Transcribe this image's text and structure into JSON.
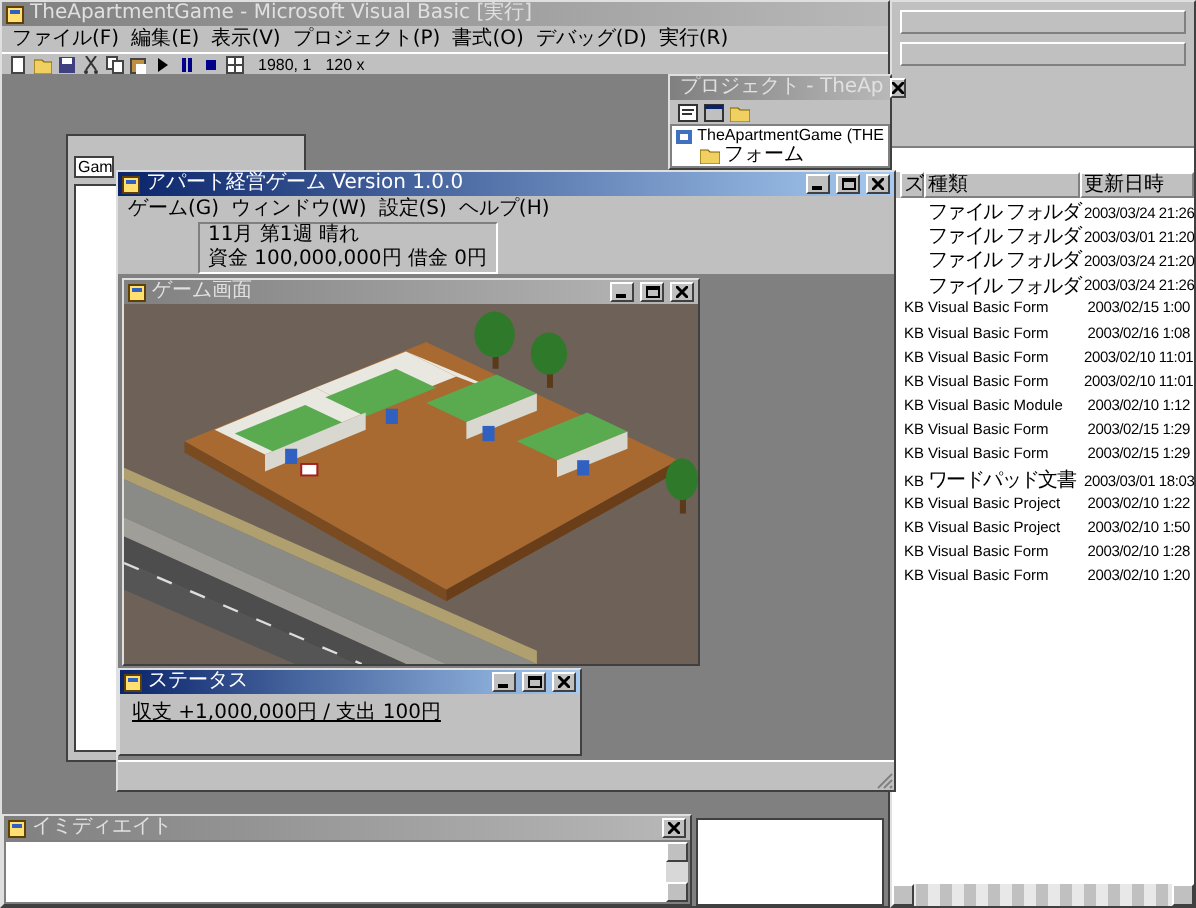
{
  "ide": {
    "title": "TheApartmentGame - Microsoft Visual Basic [実行]",
    "active": false,
    "menu": [
      "ファイル(F)",
      "編集(E)",
      "表示(V)",
      "プロジェクト(P)",
      "書式(O)",
      "デバッグ(D)",
      "実行(R)"
    ],
    "toolbar_readout": "1980, 1",
    "size_readout": "120 x"
  },
  "form_designer": {
    "combo_value": "Gam"
  },
  "project_explorer": {
    "title": "プロジェクト - TheAp",
    "active": false,
    "tree": [
      {
        "label": "TheApartmentGame (THE",
        "children": [
          {
            "label": "フォーム"
          }
        ]
      }
    ]
  },
  "file_list": {
    "columns": [
      "ズ",
      "種類",
      "更新日時"
    ],
    "rows": [
      {
        "size": "",
        "type": "ファイル フォルダ",
        "modified": "2003/03/24 21:26"
      },
      {
        "size": "",
        "type": "ファイル フォルダ",
        "modified": "2003/03/01 21:20"
      },
      {
        "size": "",
        "type": "ファイル フォルダ",
        "modified": "2003/03/24 21:20"
      },
      {
        "size": "",
        "type": "ファイル フォルダ",
        "modified": "2003/03/24 21:26"
      },
      {
        "size": "KB",
        "type": "Visual Basic Form",
        "modified": "2003/02/15 1:00"
      },
      {
        "size": "KB",
        "type": "Visual Basic Form",
        "modified": "2003/02/16 1:08"
      },
      {
        "size": "KB",
        "type": "Visual Basic Form",
        "modified": "2003/02/10 11:01"
      },
      {
        "size": "KB",
        "type": "Visual Basic Form",
        "modified": "2003/02/10 11:01"
      },
      {
        "size": "KB",
        "type": "Visual Basic Module",
        "modified": "2003/02/10 1:12"
      },
      {
        "size": "KB",
        "type": "Visual Basic Form",
        "modified": "2003/02/15 1:29"
      },
      {
        "size": "KB",
        "type": "Visual Basic Form",
        "modified": "2003/02/15 1:29"
      },
      {
        "size": "KB",
        "type": "ワードパッド文書",
        "modified": "2003/03/01 18:03"
      },
      {
        "size": "KB",
        "type": "Visual Basic Project",
        "modified": "2003/02/10 1:22"
      },
      {
        "size": "KB",
        "type": "Visual Basic Project",
        "modified": "2003/02/10 1:50"
      },
      {
        "size": "KB",
        "type": "Visual Basic Form",
        "modified": "2003/02/10 1:28"
      },
      {
        "size": "KB",
        "type": "Visual Basic Form",
        "modified": "2003/02/10 1:20"
      }
    ]
  },
  "game_window": {
    "title": "アパート経営ゲーム Version 1.0.0",
    "active": true,
    "menu": [
      "ゲーム(G)",
      "ウィンドウ(W)",
      "設定(S)",
      "ヘルプ(H)"
    ],
    "info": [
      "11月 第1週 晴れ",
      "資金 100,000,000円 借金 0円"
    ],
    "view_window": {
      "title": "ゲーム画面",
      "active": false
    }
  },
  "status_window": {
    "title": "ステータス",
    "active": true,
    "text": "収支 +1,000,000円 / 支出 100円"
  },
  "immediate_window": {
    "title": "イミディエイト",
    "active": false
  }
}
